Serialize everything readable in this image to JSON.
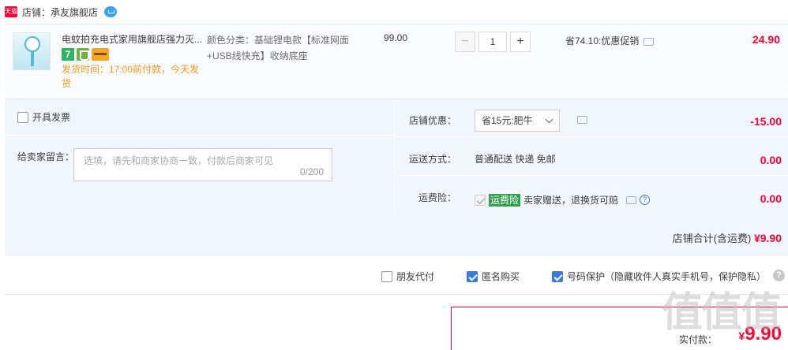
{
  "shop": {
    "badge_text": "天猫",
    "label": "店铺：承友旗舰店"
  },
  "item": {
    "title": "电蚊拍充电式家用旗舰店强力灭...",
    "icon_7": "7",
    "ship_time": "发货时间：17:00前付款，今天发货",
    "spec": "颜色分类：基础锂电款【标准网面+USB线快充】收纳底座",
    "price": "99.00",
    "qty_minus": "−",
    "qty_value": "1",
    "qty_plus": "+",
    "discount": "省74.10:优惠促销",
    "total": "24.90"
  },
  "order": {
    "invoice_label": "开具发票",
    "message_label": "给卖家留言：",
    "message_placeholder": "选填，请先和商家协商一致，付款后商家可见",
    "message_count": "0/200",
    "coupon_label": "店铺优惠：",
    "coupon_value": "省15元:肥牛",
    "coupon_amount": "-15.00",
    "shipping_label": "运送方式：",
    "shipping_value": "普通配送 快递 免邮",
    "shipping_amount": "0.00",
    "insurance_label": "运费险：",
    "insurance_tag": "运费险",
    "insurance_value": "卖家赠送，退换货可赔",
    "insurance_amount": "0.00",
    "shop_total_label": "店铺合计(含运费)",
    "shop_total_value": "¥9.90"
  },
  "options": {
    "friend_pay": "朋友代付",
    "anonymous": "匿名购买",
    "number_protect": "号码保护（隐藏收件人真实手机号，保护隐私）",
    "help": "?"
  },
  "payment": {
    "label": "实付款：",
    "currency": "¥",
    "amount": "9.90"
  },
  "watermark": "值值值",
  "colors": {
    "accent": "#ff0036",
    "panel_bg": "#f2f7ff",
    "brand_blue": "#3a7bd5"
  }
}
